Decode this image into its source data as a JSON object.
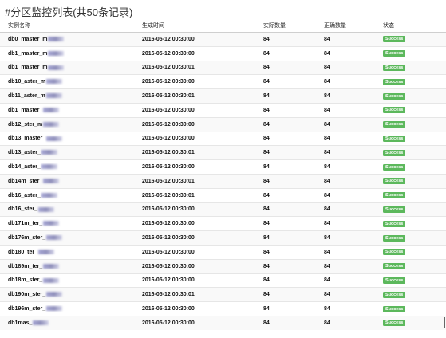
{
  "page": {
    "title": "#分区监控列表(共50条记录)"
  },
  "table": {
    "headers": [
      "实例名称",
      "生成时间",
      "实际数量",
      "正确数量",
      "状态"
    ],
    "rows": [
      {
        "name": "db0_master_m",
        "time": "2016-05-12 00:30:00",
        "actual": "84",
        "correct": "84",
        "status": "Success"
      },
      {
        "name": "db1_master_m",
        "time": "2016-05-12 00:30:00",
        "actual": "84",
        "correct": "84",
        "status": "Success"
      },
      {
        "name": "db1_master_m",
        "time": "2016-05-12 00:30:01",
        "actual": "84",
        "correct": "84",
        "status": "Success"
      },
      {
        "name": "db10_aster_m",
        "time": "2016-05-12 00:30:00",
        "actual": "84",
        "correct": "84",
        "status": "Success"
      },
      {
        "name": "db11_aster_m",
        "time": "2016-05-12 00:30:01",
        "actual": "84",
        "correct": "84",
        "status": "Success"
      },
      {
        "name": "db1_master_",
        "time": "2016-05-12 00:30:00",
        "actual": "84",
        "correct": "84",
        "status": "Success"
      },
      {
        "name": "db12_ster_m",
        "time": "2016-05-12 00:30:00",
        "actual": "84",
        "correct": "84",
        "status": "Success"
      },
      {
        "name": "db13_master_",
        "time": "2016-05-12 00:30:00",
        "actual": "84",
        "correct": "84",
        "status": "Success"
      },
      {
        "name": "db13_aster_",
        "time": "2016-05-12 00:30:01",
        "actual": "84",
        "correct": "84",
        "status": "Success"
      },
      {
        "name": "db14_aster_",
        "time": "2016-05-12 00:30:00",
        "actual": "84",
        "correct": "84",
        "status": "Success"
      },
      {
        "name": "db14m_ster_",
        "time": "2016-05-12 00:30:01",
        "actual": "84",
        "correct": "84",
        "status": "Success"
      },
      {
        "name": "db16_aster_",
        "time": "2016-05-12 00:30:01",
        "actual": "84",
        "correct": "84",
        "status": "Success"
      },
      {
        "name": "db16_ster_",
        "time": "2016-05-12 00:30:00",
        "actual": "84",
        "correct": "84",
        "status": "Success"
      },
      {
        "name": "db171m_ter_",
        "time": "2016-05-12 00:30:00",
        "actual": "84",
        "correct": "84",
        "status": "Success"
      },
      {
        "name": "db176m_ster_",
        "time": "2016-05-12 00:30:00",
        "actual": "84",
        "correct": "84",
        "status": "Success"
      },
      {
        "name": "db180_ter_",
        "time": "2016-05-12 00:30:00",
        "actual": "84",
        "correct": "84",
        "status": "Success"
      },
      {
        "name": "db189m_ter_",
        "time": "2016-05-12 00:30:00",
        "actual": "84",
        "correct": "84",
        "status": "Success"
      },
      {
        "name": "db18m_ster_",
        "time": "2016-05-12 00:30:00",
        "actual": "84",
        "correct": "84",
        "status": "Success"
      },
      {
        "name": "db190m_ster_",
        "time": "2016-05-12 00:30:01",
        "actual": "84",
        "correct": "84",
        "status": "Success"
      },
      {
        "name": "db196m_ster_",
        "time": "2016-05-12 00:30:00",
        "actual": "84",
        "correct": "84",
        "status": "Success"
      },
      {
        "name": "db1mas_",
        "time": "2016-05-12 00:30:00",
        "actual": "84",
        "correct": "84",
        "status": "Success"
      }
    ]
  },
  "colors": {
    "success_badge": "#5cb85c",
    "row_stripe": "#f9f9f9"
  }
}
